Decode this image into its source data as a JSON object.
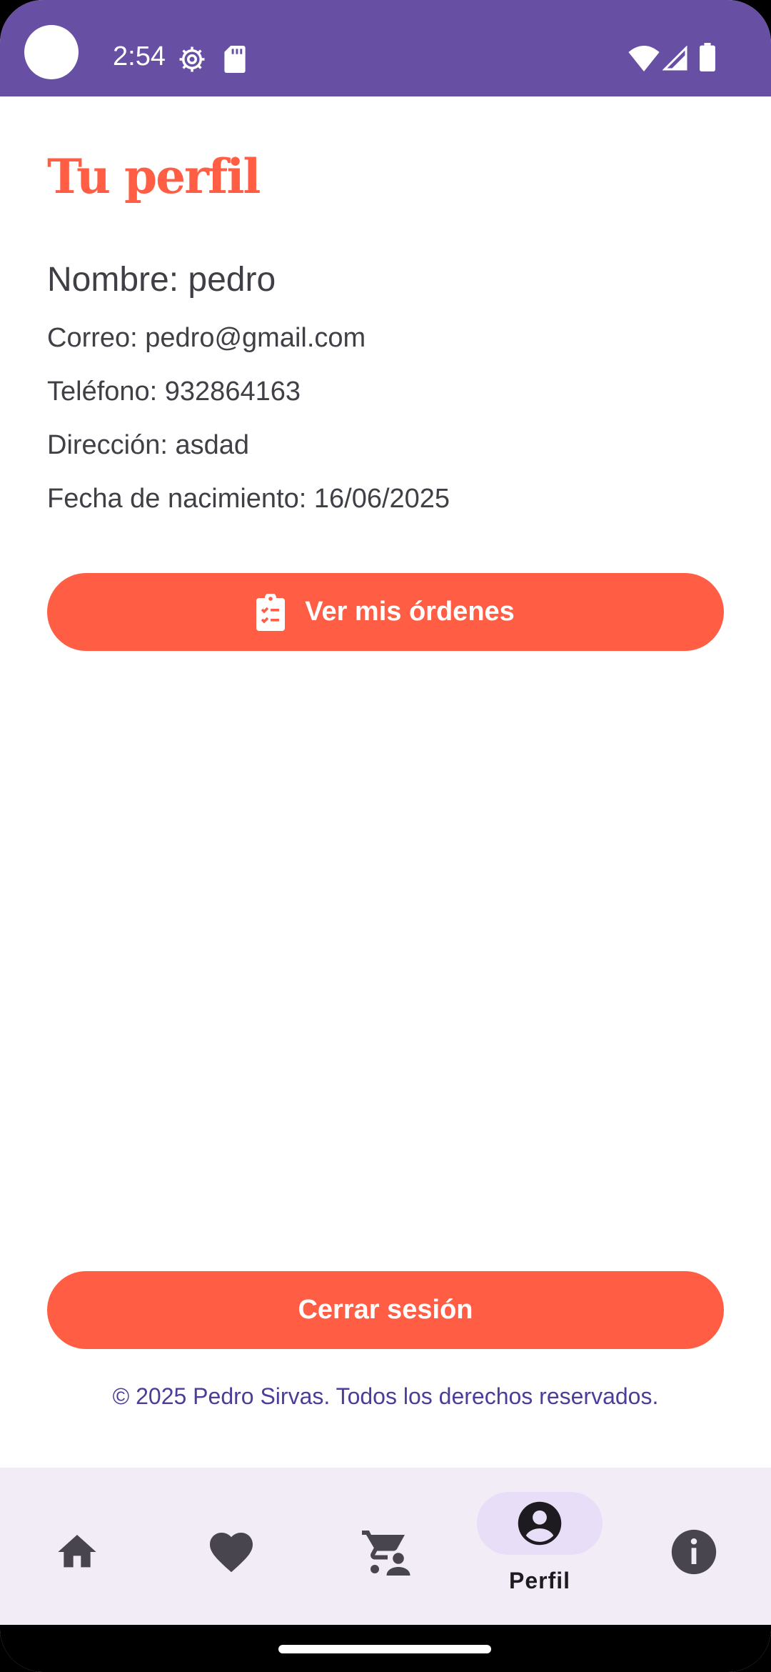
{
  "status_bar": {
    "time": "2:54",
    "icons": [
      "settings-gear-icon",
      "sd-card-icon",
      "wifi-icon",
      "cell-signal-icon",
      "battery-icon"
    ]
  },
  "profile": {
    "title": "Tu perfil",
    "name_line": "Nombre: pedro",
    "email_line": "Correo: pedro@gmail.com",
    "phone_line": "Teléfono: 932864163",
    "address_line": "Dirección: asdad",
    "birth_line": "Fecha de nacimiento: 16/06/2025"
  },
  "actions": {
    "orders_label": "Ver mis órdenes",
    "orders_icon": "clipboard-checklist-icon",
    "logout_label": "Cerrar sesión"
  },
  "footer": {
    "copyright": "© 2025 Pedro Sirvas. Todos los derechos reservados."
  },
  "bottom_nav": {
    "items": [
      {
        "icon": "home-icon",
        "label": "",
        "active": false
      },
      {
        "icon": "heart-icon",
        "label": "",
        "active": false
      },
      {
        "icon": "cart-person-icon",
        "label": "",
        "active": false
      },
      {
        "icon": "account-circle-icon",
        "label": "Perfil",
        "active": true
      },
      {
        "icon": "info-icon",
        "label": "",
        "active": false
      }
    ]
  },
  "colors": {
    "primary_purple": "#6750A4",
    "accent_orange": "#FF5E45",
    "nav_background": "#F2ECF7",
    "nav_active_pill": "#E8DEF8",
    "footer_text": "#4C3D99"
  }
}
